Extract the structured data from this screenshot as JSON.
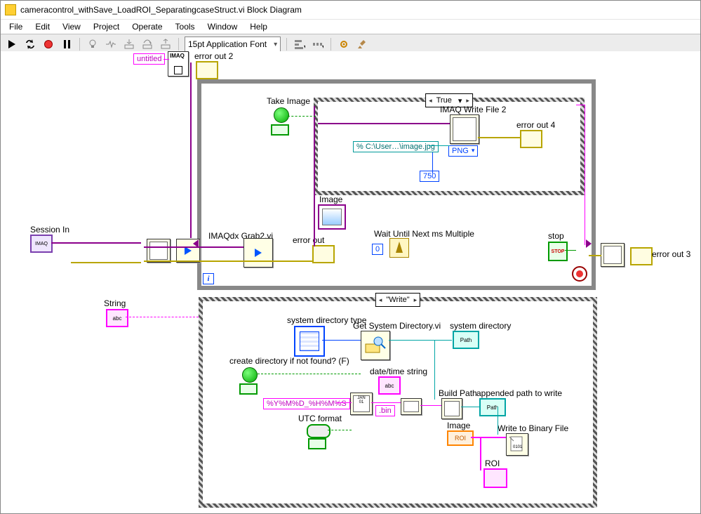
{
  "window": {
    "title": "cameracontrol_withSave_LoadROI_SeparatingcaseStruct.vi Block Diagram"
  },
  "menu": {
    "file": "File",
    "edit": "Edit",
    "view": "View",
    "project": "Project",
    "operate": "Operate",
    "tools": "Tools",
    "window": "Window",
    "help": "Help"
  },
  "toolbar": {
    "font": "15pt Application Font"
  },
  "top": {
    "untitled": "untitled",
    "imaq": "IMAQ",
    "error_out_2": "error out 2"
  },
  "loop": {
    "take_image": "Take Image",
    "inner_case_selector": "True",
    "imaq_write": "IMAQ Write File 2",
    "png": "PNG",
    "error_out_4": "error out 4",
    "path_const": "% C:\\User…\\image.jpg",
    "num_750": "750",
    "image_label": "Image",
    "session_in": "Session In",
    "imaq_sess": "IMAQ",
    "grab": "IMAQdx Grab2.vi",
    "error_out": "error out",
    "wait_label": "Wait Until Next ms Multiple",
    "wait_val": "0",
    "stop": "stop",
    "stop_btn": "STOP",
    "error_out_3": "error out 3",
    "i": "i"
  },
  "case2": {
    "selector": "\"Write\"",
    "string": "String",
    "abc": "abc",
    "sys_dir_type": "system directory type",
    "get_sys_dir": "Get System Directory.vi",
    "sys_dir": "system directory",
    "path_tag": "Path",
    "create_dir": "create directory if not found? (F)",
    "date_time": "date/time string",
    "abc2": "abc",
    "fmt": "%Y%M%D_%H%M%S",
    "bin": ".bin",
    "utc": "UTC format",
    "build_path": "Build Path",
    "appended": "appended path to write",
    "path_tag2": "Path",
    "image": "Image",
    "roi_tag": "ROI",
    "write_bin": "Write to Binary File",
    "roi": "ROI"
  }
}
